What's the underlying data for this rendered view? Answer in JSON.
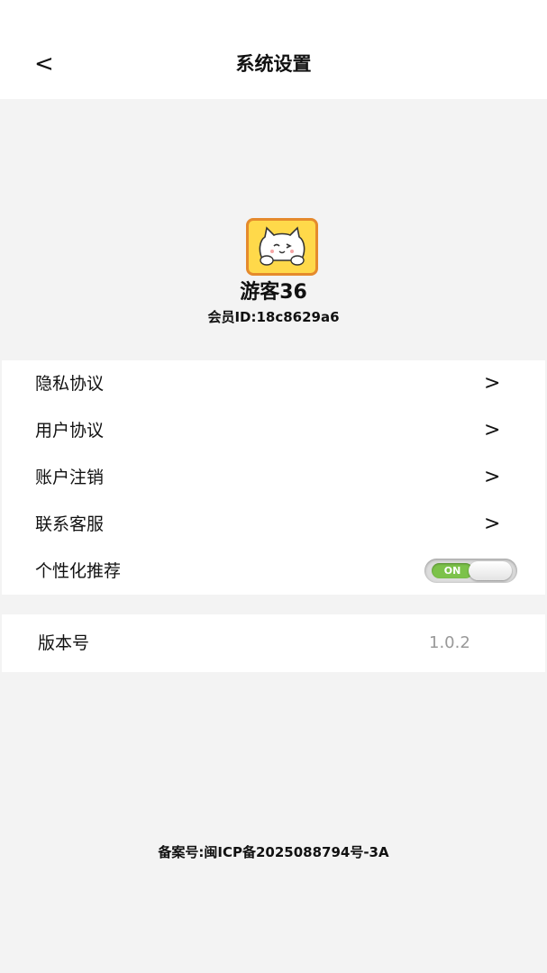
{
  "header": {
    "back_label": "<",
    "title": "系统设置"
  },
  "profile": {
    "avatar_icon": "cat-avatar-icon",
    "username": "游客36",
    "member_id": "会员ID:18c8629a6"
  },
  "menu": {
    "items": [
      {
        "label": "隐私协议",
        "chevron": ">"
      },
      {
        "label": "用户协议",
        "chevron": ">"
      },
      {
        "label": "账户注销",
        "chevron": ">"
      },
      {
        "label": "联系客服",
        "chevron": ">"
      }
    ],
    "recommend": {
      "label": "个性化推荐",
      "toggle_text": "ON",
      "enabled": true
    }
  },
  "version": {
    "label": "版本号",
    "value": "1.0.2"
  },
  "footer": {
    "icp": "备案号:闽ICP备2025088794号-3A"
  },
  "colors": {
    "toggle_on": "#7cc24a",
    "avatar_bg": "#ffd94a",
    "avatar_border": "#e58a2c"
  }
}
